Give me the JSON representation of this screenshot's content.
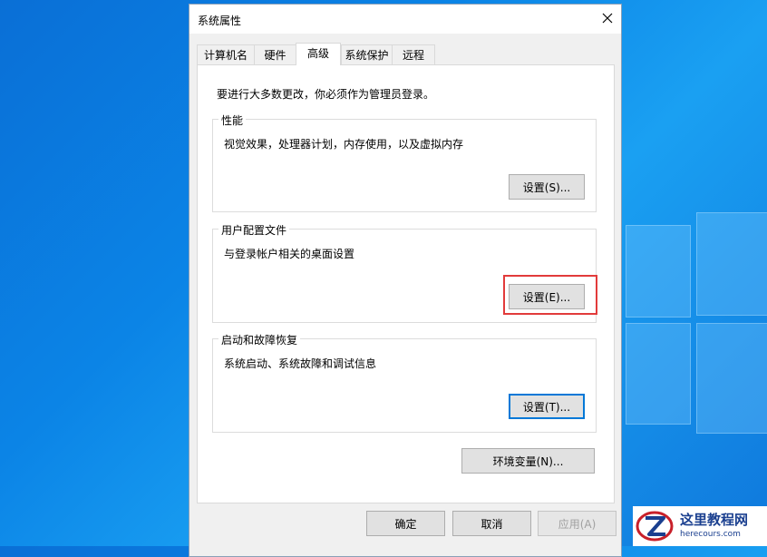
{
  "window": {
    "title": "系统属性",
    "close_glyph": "✕"
  },
  "tabs": [
    {
      "label": "计算机名"
    },
    {
      "label": "硬件"
    },
    {
      "label": "高级",
      "active": true
    },
    {
      "label": "系统保护"
    },
    {
      "label": "远程"
    }
  ],
  "advanced": {
    "intro": "要进行大多数更改，你必须作为管理员登录。",
    "performance": {
      "legend": "性能",
      "desc": "视觉效果，处理器计划，内存使用，以及虚拟内存",
      "button": "设置(S)..."
    },
    "user_profiles": {
      "legend": "用户配置文件",
      "desc": "与登录帐户相关的桌面设置",
      "button": "设置(E)..."
    },
    "startup_recovery": {
      "legend": "启动和故障恢复",
      "desc": "系统启动、系统故障和调试信息",
      "button": "设置(T)..."
    },
    "env_vars_button": "环境变量(N)..."
  },
  "footer": {
    "ok": "确定",
    "cancel": "取消",
    "apply": "应用(A)"
  },
  "watermark": {
    "title": "这里教程网",
    "url": "herecours.com"
  },
  "colors": {
    "desktop": "#0b84e6",
    "highlight": "#e23b3b",
    "focus": "#0078d7"
  }
}
